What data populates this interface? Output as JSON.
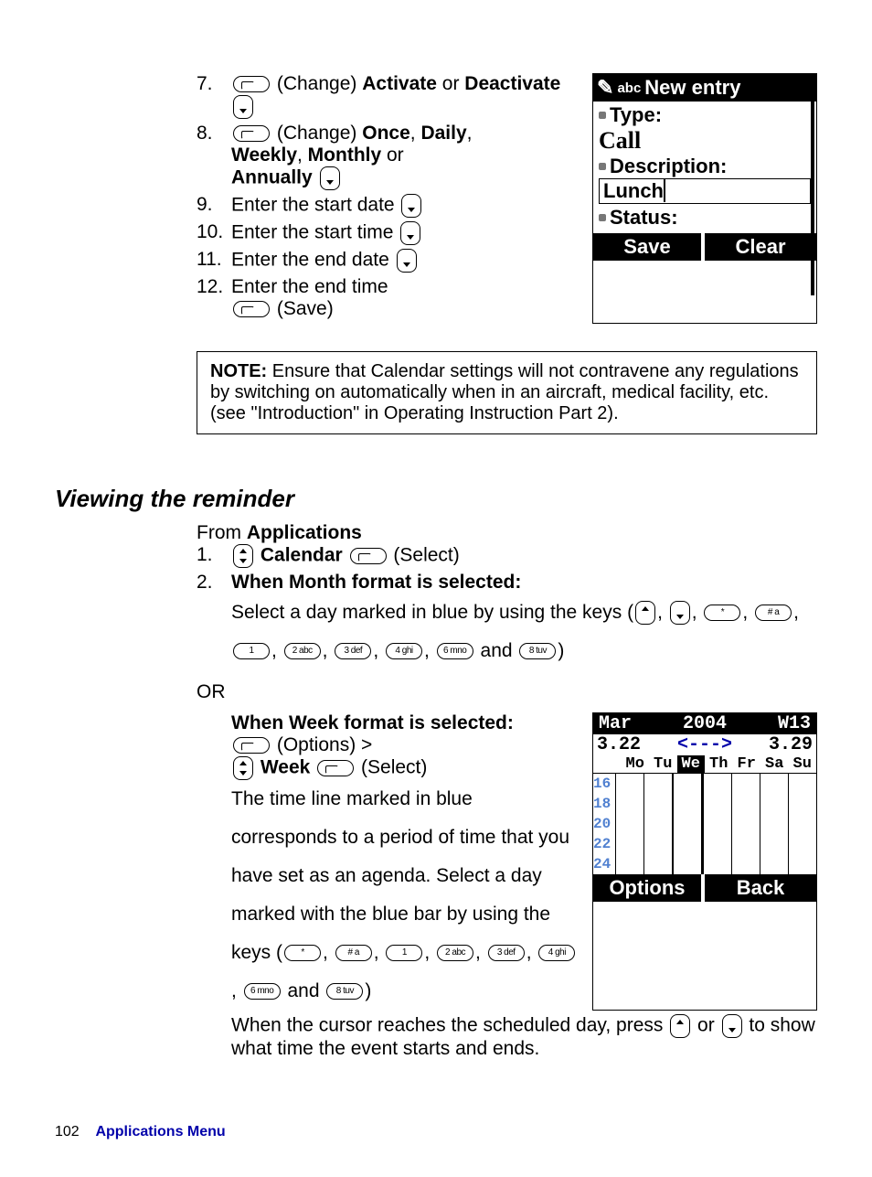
{
  "steps": {
    "s7": {
      "num": "7.",
      "prefix": "(Change) ",
      "b1": "Activate",
      "mid": " or ",
      "b2": "Deactivate"
    },
    "s8": {
      "num": "8.",
      "prefix": "(Change) ",
      "b1": "Once",
      "c1": ", ",
      "b2": "Daily",
      "c2": ", ",
      "b3": "Weekly",
      "c3": ", ",
      "b4": "Monthly",
      "c4": " or ",
      "b5": "Annually"
    },
    "s9": {
      "num": "9.",
      "text": "Enter the start date"
    },
    "s10": {
      "num": "10.",
      "text": "Enter the start time"
    },
    "s11": {
      "num": "11.",
      "text": "Enter the end date"
    },
    "s12": {
      "num": "12.",
      "text": "Enter the end time",
      "save": "(Save)"
    }
  },
  "phone1": {
    "mode": "abc",
    "title": "New entry",
    "type_label": "Type:",
    "type_value": "Call",
    "desc_label": "Description:",
    "desc_value": "Lunch",
    "status_label": "Status:",
    "soft_left": "Save",
    "soft_right": "Clear"
  },
  "note": {
    "label": "NOTE:",
    "text": " Ensure that Calendar settings will not contravene any regulations by switching on automatically when in an aircraft, medical facility, etc. (see \"Introduction\" in Operating Instruction Part 2)."
  },
  "section2": {
    "heading": "Viewing the reminder",
    "from": "From ",
    "apps": "Applications",
    "step1_num": "1.",
    "calendar": "Calendar",
    "select": "(Select)",
    "step2_num": "2.",
    "month_heading": "When Month format is selected:",
    "month_text": "Select a day marked in blue by using the keys (",
    "key_list": [
      "*",
      "# a",
      "1",
      "2 abc",
      "3 def",
      "4 ghi",
      "6 mno",
      "8 tuv"
    ],
    "and": " and ",
    "close": ")",
    "or": "OR",
    "week_heading": "When Week format is selected:",
    "options": "(Options) > ",
    "week": "Week",
    "week_text": "The time line marked in blue corresponds to a period of time that you have set as an agenda. Select a day marked with the blue bar by using the keys (",
    "cursor_text": "When the cursor reaches the scheduled day, press ",
    "cursor_or": " or ",
    "cursor_end": " to show what time the event starts and ends."
  },
  "phone2": {
    "month": "Mar",
    "year": "2004",
    "wk": "W13",
    "d1": "3.22",
    "arrow": "<--->",
    "d2": "3.29",
    "days": [
      "Mo",
      "Tu",
      "We",
      "Th",
      "Fr",
      "Sa",
      "Su"
    ],
    "days_sel_idx": 2,
    "hours": [
      "16",
      "18",
      "20",
      "22",
      "24"
    ],
    "soft_left": "Options",
    "soft_right": "Back"
  },
  "footer": {
    "page": "102",
    "title": "Applications Menu"
  }
}
